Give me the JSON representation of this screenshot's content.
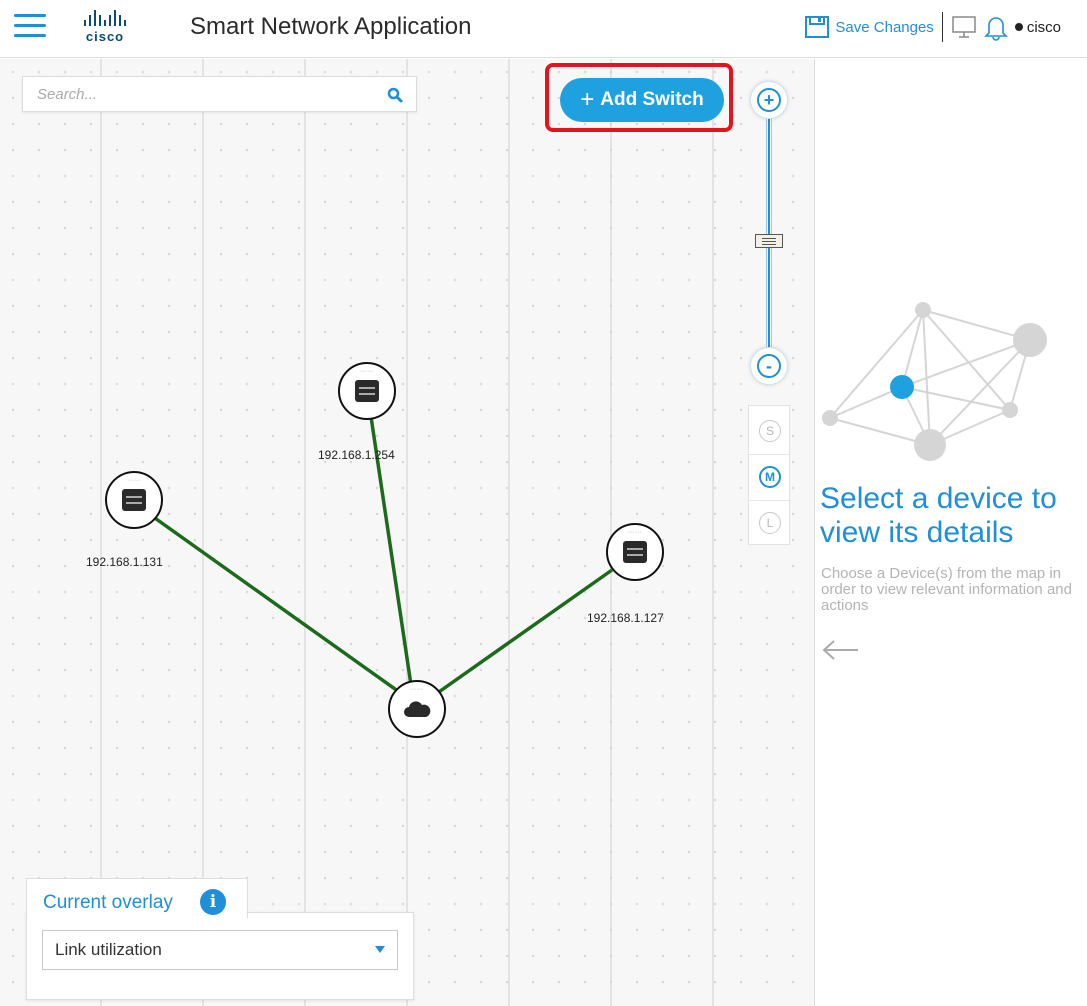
{
  "header": {
    "menu_icon": "hamburger-menu-icon",
    "logo_text": "cisco",
    "title": "Smart Network Application",
    "save_label": "Save Changes",
    "user_name": "cisco",
    "icons": [
      "save-icon",
      "monitor-icon",
      "bell-icon"
    ]
  },
  "search": {
    "placeholder": "Search..."
  },
  "toolbar": {
    "add_switch_label": "Add Switch",
    "highlight_color": "#e5141b"
  },
  "zoom": {
    "plus_label": "+",
    "minus_label": "-"
  },
  "node_size": {
    "options": [
      "S",
      "M",
      "L"
    ],
    "selected": "M"
  },
  "topology": {
    "nodes": [
      {
        "id": "switch-254",
        "label": "192.168.1.254",
        "type": "switch"
      },
      {
        "id": "switch-131",
        "label": "192.168.1.131",
        "type": "switch"
      },
      {
        "id": "switch-127",
        "label": "192.168.1.127",
        "type": "switch"
      },
      {
        "id": "cloud",
        "label": "",
        "type": "cloud"
      }
    ],
    "link_color": "#1b6b1b"
  },
  "overlay": {
    "title": "Current overlay",
    "info_label": "i",
    "selected": "Link utilization"
  },
  "details_panel": {
    "title": "Select a device to view its details",
    "description": "Choose a Device(s) from the map in order to view relevant information and actions"
  },
  "colors": {
    "accent": "#1f8fd8",
    "button": "#1fa1e0"
  }
}
